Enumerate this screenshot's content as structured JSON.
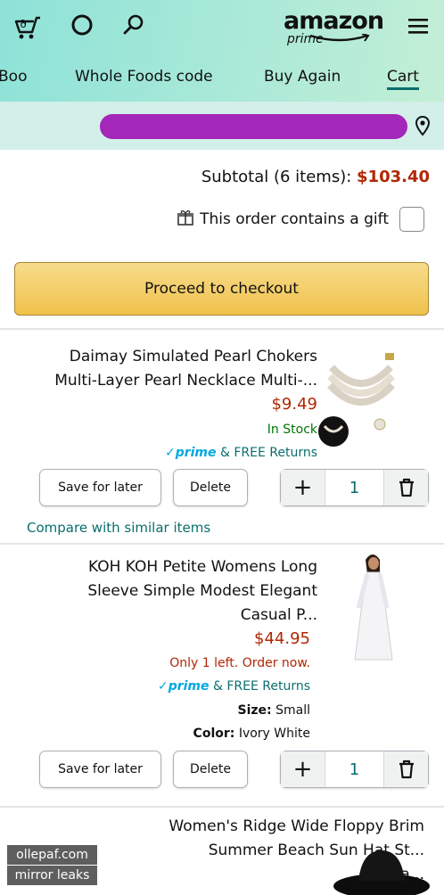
{
  "header": {
    "logo_word": "amazon",
    "logo_sub": "prime",
    "tabs": [
      {
        "label": "Cart",
        "active": true
      },
      {
        "label": "Buy Again"
      },
      {
        "label": "Whole Foods code"
      },
      {
        "label": "Boo"
      }
    ]
  },
  "cart": {
    "subtotal_label": "Subtotal (6 items):",
    "subtotal_value": "$103.40",
    "gift_label": "This order contains a gift",
    "gift_checked": false,
    "checkout_label": "Proceed to checkout"
  },
  "items": [
    {
      "title_lines": [
        "Daimay Simulated Pearl Chokers",
        "Multi-Layer Pearl Necklace Multi-..."
      ],
      "price": "$9.49",
      "stock": "In Stock",
      "prime_label": "prime",
      "returns": "& FREE Returns",
      "qty": "1",
      "delete_label": "Delete",
      "save_label": "Save for later",
      "compare_label": "Compare with similar items"
    },
    {
      "title_lines": [
        "KOH KOH Petite Womens Long",
        "Sleeve Simple Modest Elegant",
        "Casual P..."
      ],
      "price": "$44.95",
      "stock": "Only 1 left. Order now.",
      "prime_label": "prime",
      "returns": "& FREE Returns",
      "size_label": "Size:",
      "size_value": "Small",
      "color_label": "Color:",
      "color_value": "Ivory White",
      "qty": "1",
      "delete_label": "Delete",
      "save_label": "Save for later"
    },
    {
      "title_lines": [
        "Women's Ridge Wide Floppy Brim",
        "Summer Beach Sun Hat St...",
        "Pa..."
      ]
    }
  ],
  "watermark": {
    "line1": "ollepaf.com",
    "line2": "mirror leaks"
  },
  "colors": {
    "accent": "#0a6e6e",
    "price": "#b12704",
    "prime": "#00a8e1",
    "redaction": "#a327b8",
    "checkout": "#f0c14b"
  }
}
